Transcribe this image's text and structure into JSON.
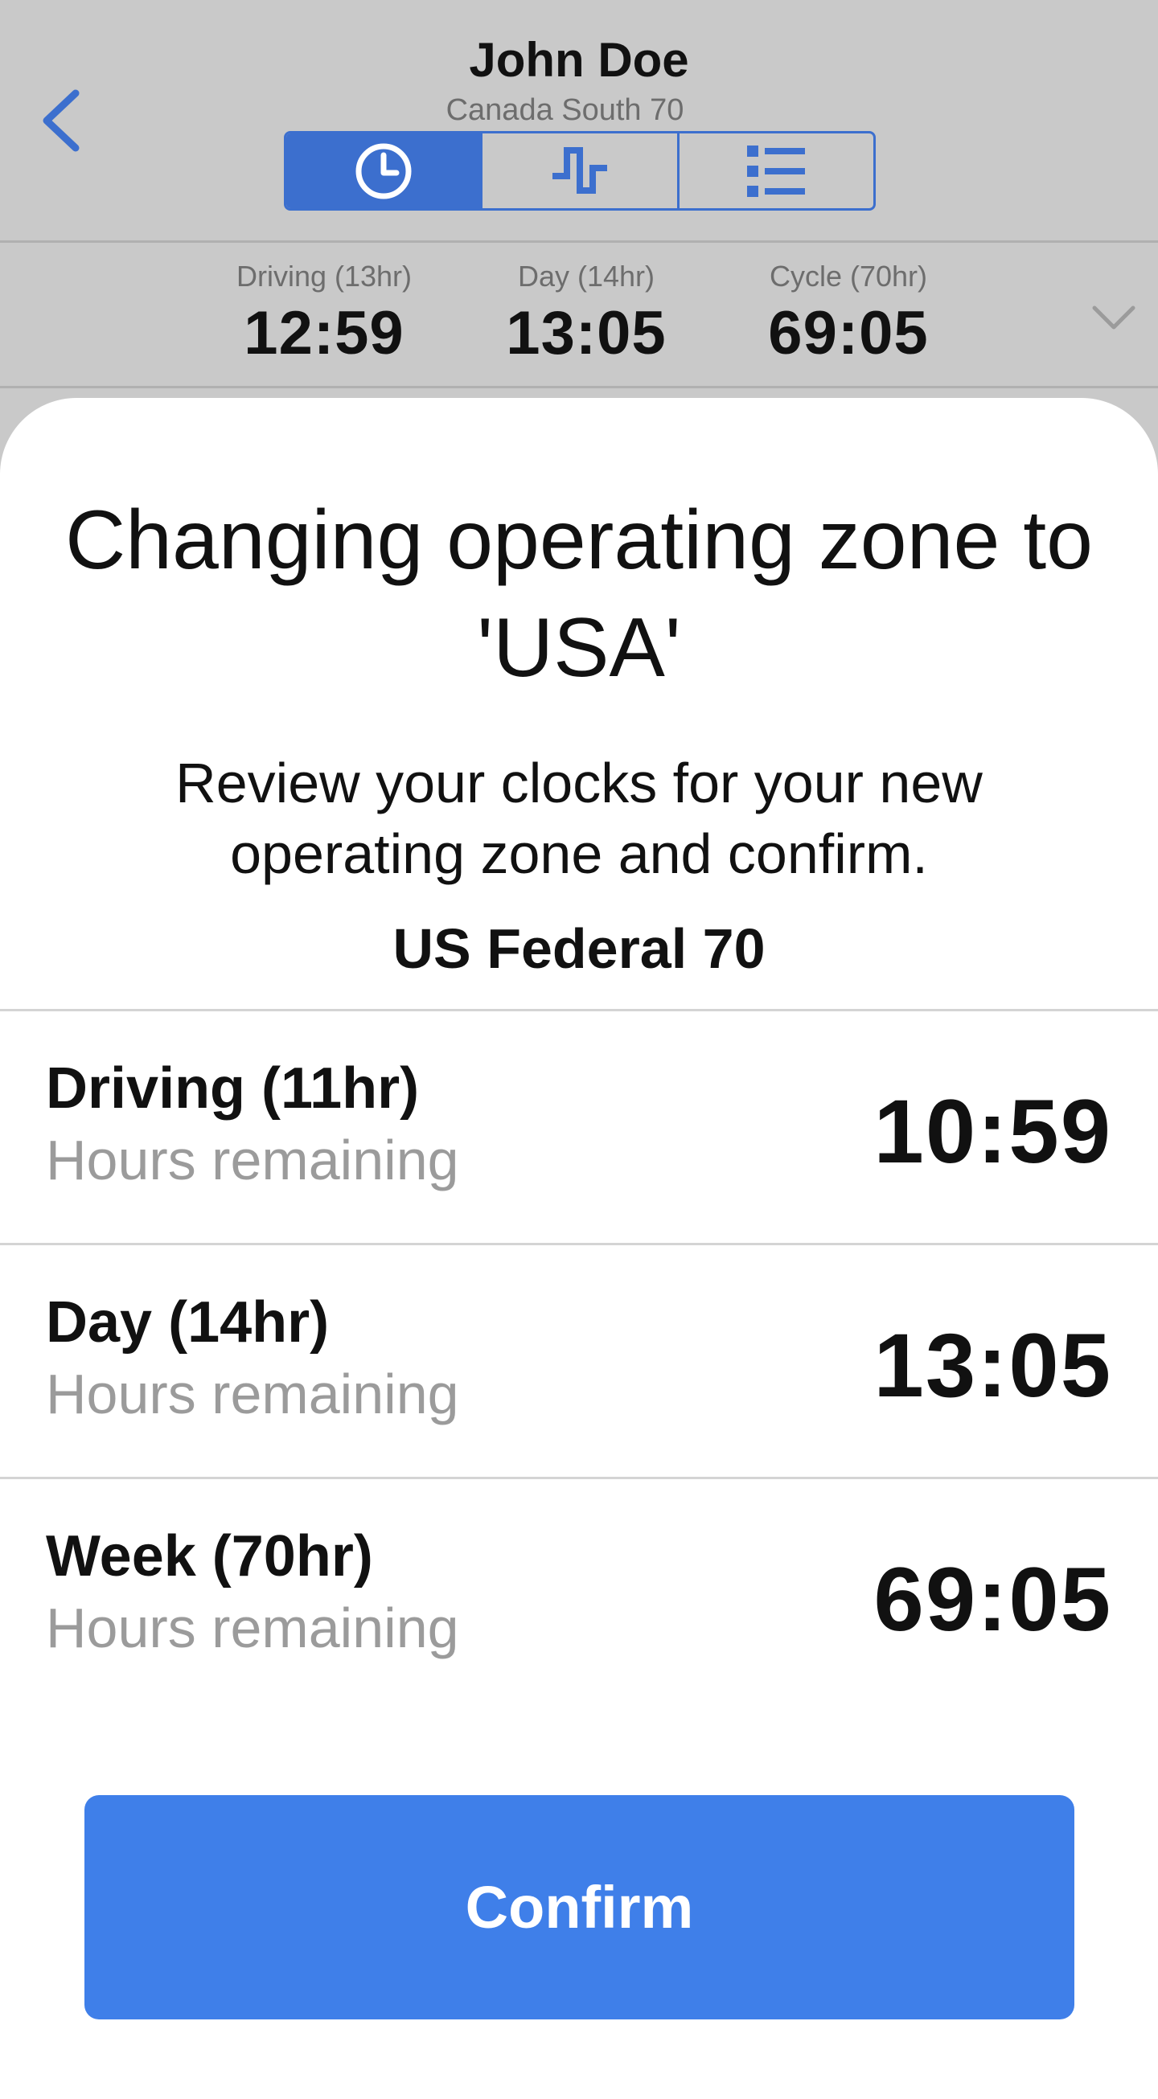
{
  "header": {
    "driver_name": "John Doe",
    "ruleset": "Canada South 70",
    "tabs": [
      {
        "icon": "clock-icon",
        "active": true
      },
      {
        "icon": "logs-graph-icon",
        "active": false
      },
      {
        "icon": "list-icon",
        "active": false
      }
    ]
  },
  "clocks": [
    {
      "label": "Driving (13hr)",
      "value": "12:59"
    },
    {
      "label": "Day (14hr)",
      "value": "13:05"
    },
    {
      "label": "Cycle (70hr)",
      "value": "69:05"
    }
  ],
  "modal": {
    "title": "Changing operating zone to 'USA'",
    "description": "Review your clocks for your new operating zone and confirm.",
    "ruleset": "US Federal 70",
    "rows": [
      {
        "label": "Driving (11hr)",
        "sub": "Hours remaining",
        "value": "10:59"
      },
      {
        "label": "Day (14hr)",
        "sub": "Hours remaining",
        "value": "13:05"
      },
      {
        "label": "Week (70hr)",
        "sub": "Hours remaining",
        "value": "69:05"
      }
    ],
    "confirm_label": "Confirm"
  },
  "colors": {
    "accent": "#3c6fce",
    "button": "#3f7fe9",
    "overlay": "#c9c9c9"
  }
}
